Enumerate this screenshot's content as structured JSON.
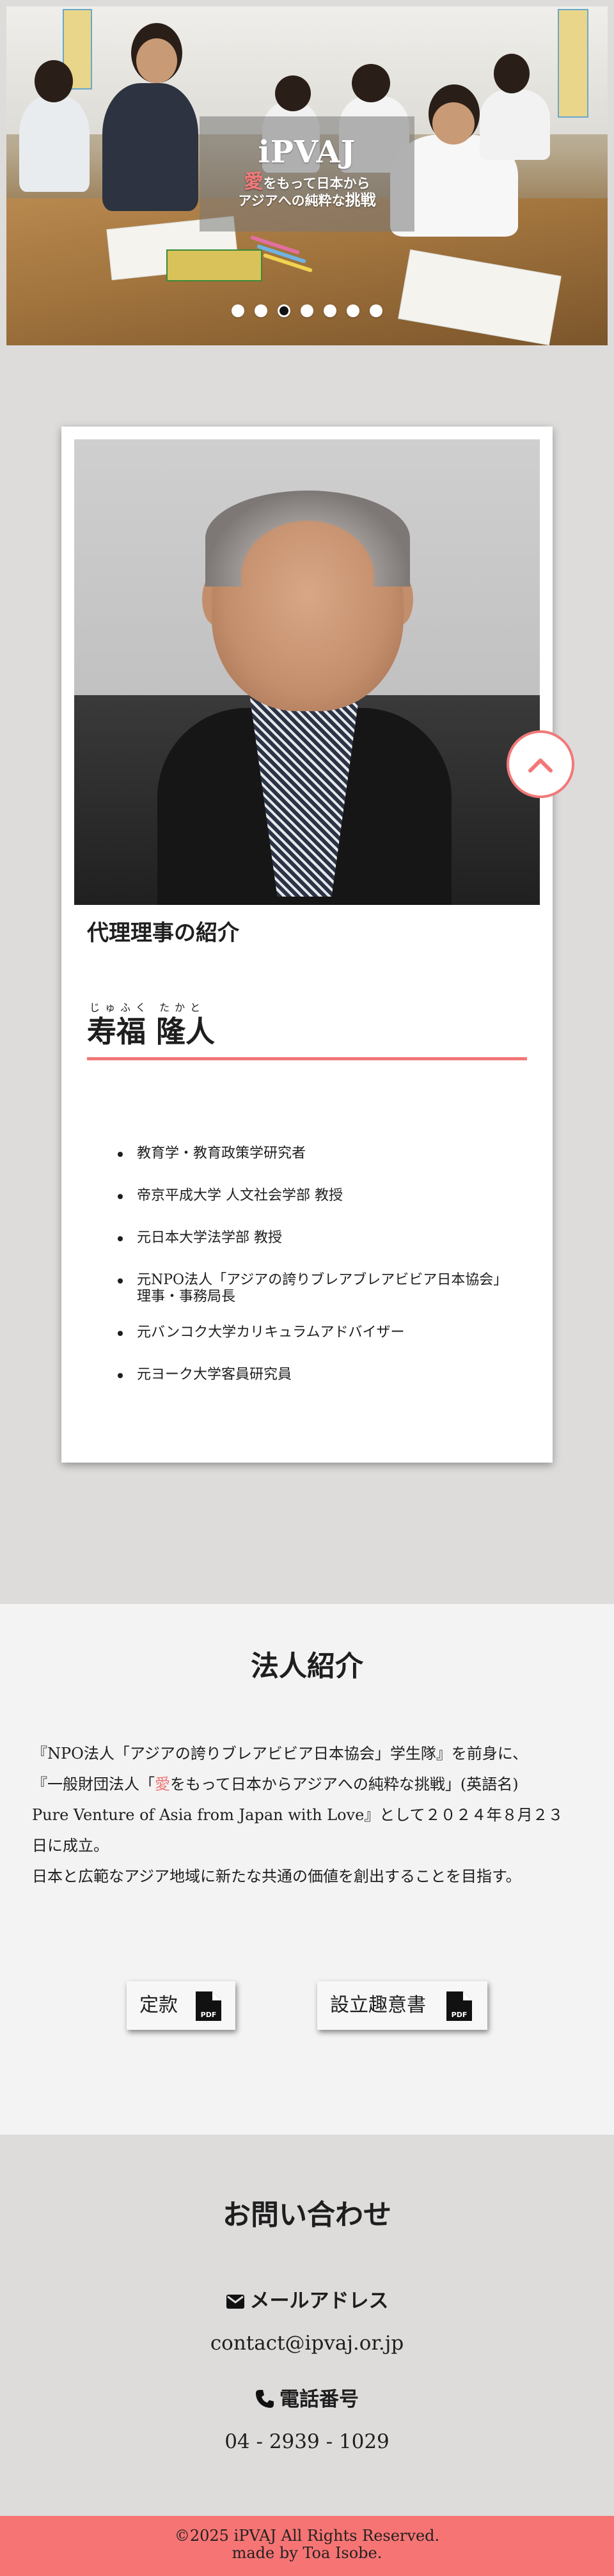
{
  "hero": {
    "logo": "iPVAJ",
    "tagline_love": "愛",
    "tagline_rest1": "をもって日本から",
    "tagline_line2": "アジアへの純粋な",
    "tagline_stress": "挑戦",
    "slides": 7,
    "active_slide": 3
  },
  "profile": {
    "heading": "代理理事の紹介",
    "name_ruby": "じゅふく たかと",
    "name": "寿福 隆人",
    "credentials": [
      "教育学・教育政策学研究者",
      "帝京平成大学 人文社会学部 教授",
      "元日本大学法学部 教授",
      "元NPO法人「アジアの誇りブレアブレアビビア日本協会」理事・事務局長",
      "元バンコク大学カリキュラムアドバイザー",
      "元ヨーク大学客員研究員"
    ]
  },
  "corp": {
    "title": "法人紹介",
    "line1": "『NPO法人「アジアの誇りブレアビビア日本協会」学生隊』を前身に、",
    "line2_a": "『一般財団法人「",
    "line2_love": "愛",
    "line2_b": "をもって日本からアジアへの純粋な挑戦」(英語名)",
    "line3": "Pure Venture of Asia from Japan with Love』として２０２４年８月２３",
    "line4": "日に成立。",
    "line5": "日本と広範なアジア地域に新たな共通の価値を創出することを目指す。",
    "btn_articles": "定款",
    "btn_prospectus": "設立趣意書",
    "pdf_label": "PDF"
  },
  "contact": {
    "title": "お問い合わせ",
    "email_label": "メールアドレス",
    "email": "contact@ipvaj.or.jp",
    "phone_label": "電話番号",
    "phone": "04 - 2939 - 1029"
  },
  "footer": {
    "copyright": "©2025 iPVAJ All Rights Reserved.",
    "credit": "made by Toa Isobe."
  },
  "colors": {
    "accent": "#f27878",
    "footer": "#f77474",
    "page_bg": "#dddcdb"
  },
  "icons": [
    "envelope-icon",
    "phone-icon",
    "pdf-file-icon",
    "chevron-up-icon"
  ]
}
